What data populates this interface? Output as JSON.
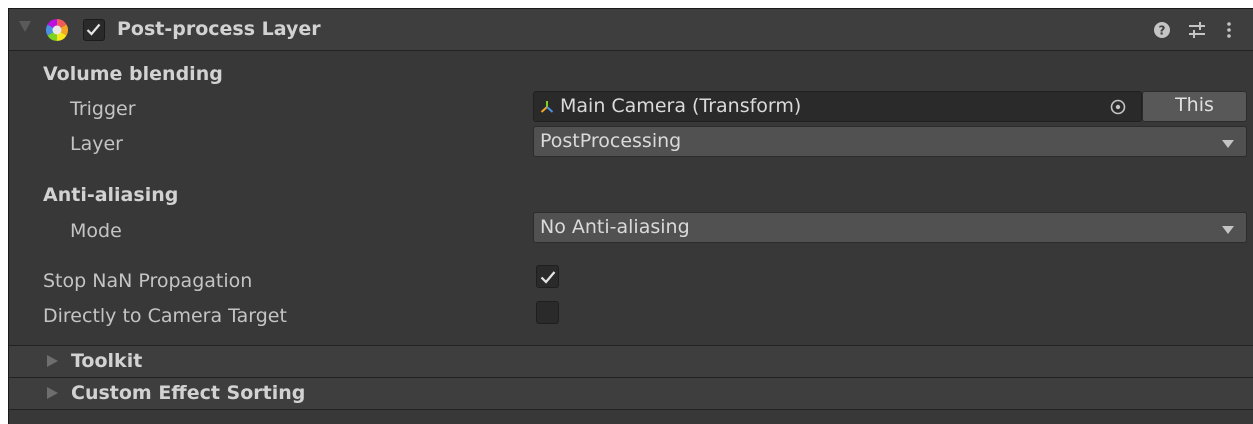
{
  "component": {
    "title": "Post-process Layer",
    "enabled": true,
    "header_icons": [
      "help-icon",
      "presets-icon",
      "kebab-menu-icon"
    ]
  },
  "volume_blending": {
    "heading": "Volume blending",
    "trigger": {
      "label": "Trigger",
      "value": "Main Camera (Transform)",
      "value_icon": "transform-icon",
      "picker_icon": "object-picker-icon",
      "this_button": "This"
    },
    "layer": {
      "label": "Layer",
      "value": "PostProcessing"
    }
  },
  "anti_aliasing": {
    "heading": "Anti-aliasing",
    "mode": {
      "label": "Mode",
      "value": "No Anti-aliasing"
    }
  },
  "options": {
    "stop_nan": {
      "label": "Stop NaN Propagation",
      "checked": true
    },
    "direct_to_target": {
      "label": "Directly to Camera Target",
      "checked": false
    }
  },
  "foldouts": [
    {
      "label": "Toolkit",
      "expanded": false
    },
    {
      "label": "Custom Effect Sorting",
      "expanded": false
    }
  ],
  "colors": {
    "panel_bg": "#383838",
    "header_bg": "#3e3e3e",
    "field_bg": "#2a2a2a",
    "dropdown_bg": "#515151",
    "text": "#c4c4c4"
  }
}
